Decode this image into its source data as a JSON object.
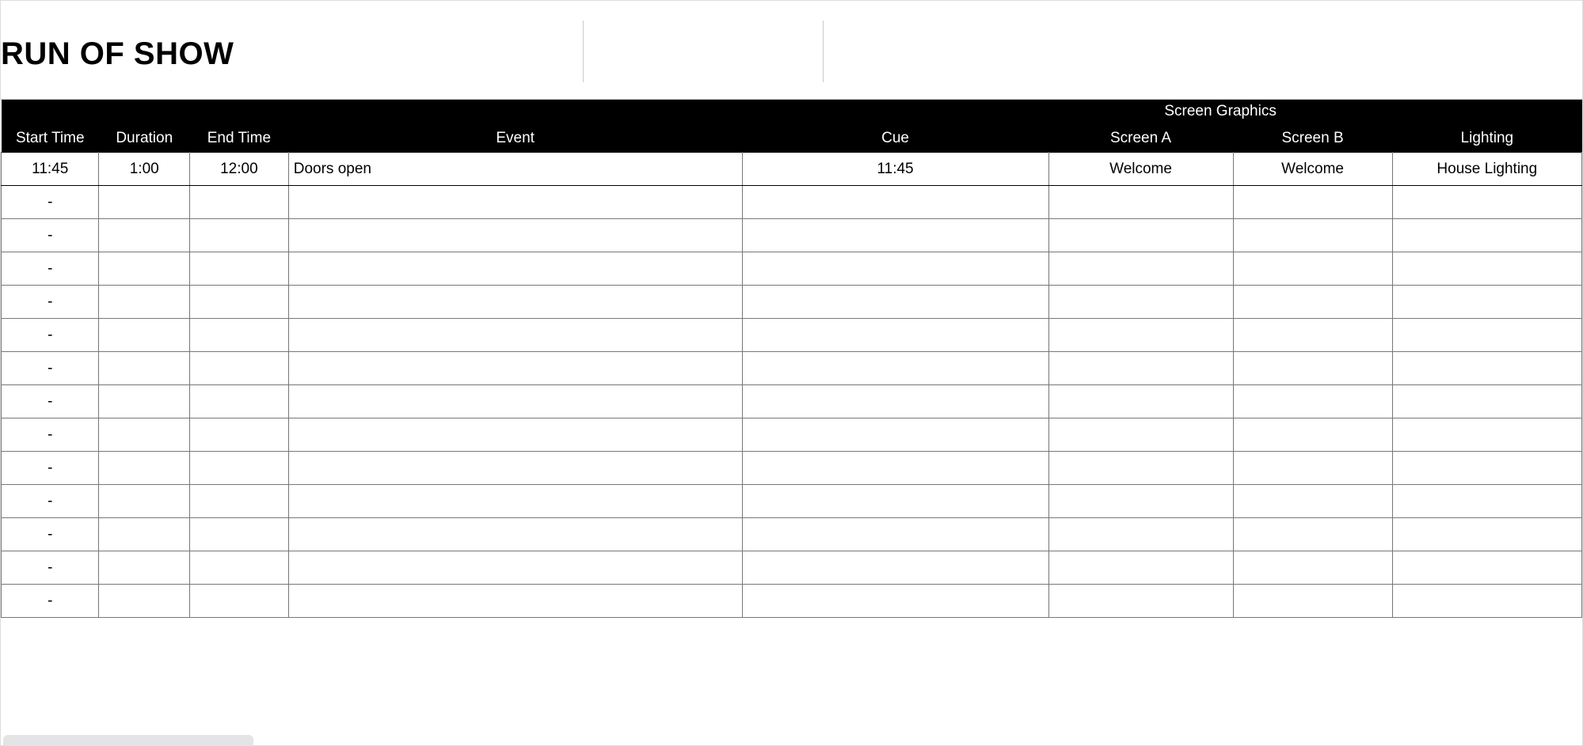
{
  "title": "RUN OF SHOW",
  "columns": {
    "group_screen_graphics": "Screen Graphics",
    "start_time": "Start Time",
    "duration": "Duration",
    "end_time": "End Time",
    "event": "Event",
    "cue": "Cue",
    "screen_a": "Screen A",
    "screen_b": "Screen B",
    "lighting": "Lighting"
  },
  "rows": [
    {
      "start_time": "11:45",
      "duration": "1:00",
      "end_time": "12:00",
      "event": "Doors open",
      "cue": "11:45",
      "screen_a": "Welcome",
      "screen_b": "Welcome",
      "lighting": "House Lighting"
    },
    {
      "start_time": "-",
      "duration": "",
      "end_time": "",
      "event": "",
      "cue": "",
      "screen_a": "",
      "screen_b": "",
      "lighting": ""
    },
    {
      "start_time": "-",
      "duration": "",
      "end_time": "",
      "event": "",
      "cue": "",
      "screen_a": "",
      "screen_b": "",
      "lighting": ""
    },
    {
      "start_time": "-",
      "duration": "",
      "end_time": "",
      "event": "",
      "cue": "",
      "screen_a": "",
      "screen_b": "",
      "lighting": ""
    },
    {
      "start_time": "-",
      "duration": "",
      "end_time": "",
      "event": "",
      "cue": "",
      "screen_a": "",
      "screen_b": "",
      "lighting": ""
    },
    {
      "start_time": "-",
      "duration": "",
      "end_time": "",
      "event": "",
      "cue": "",
      "screen_a": "",
      "screen_b": "",
      "lighting": ""
    },
    {
      "start_time": "-",
      "duration": "",
      "end_time": "",
      "event": "",
      "cue": "",
      "screen_a": "",
      "screen_b": "",
      "lighting": ""
    },
    {
      "start_time": "-",
      "duration": "",
      "end_time": "",
      "event": "",
      "cue": "",
      "screen_a": "",
      "screen_b": "",
      "lighting": ""
    },
    {
      "start_time": "-",
      "duration": "",
      "end_time": "",
      "event": "",
      "cue": "",
      "screen_a": "",
      "screen_b": "",
      "lighting": ""
    },
    {
      "start_time": "-",
      "duration": "",
      "end_time": "",
      "event": "",
      "cue": "",
      "screen_a": "",
      "screen_b": "",
      "lighting": ""
    },
    {
      "start_time": "-",
      "duration": "",
      "end_time": "",
      "event": "",
      "cue": "",
      "screen_a": "",
      "screen_b": "",
      "lighting": ""
    },
    {
      "start_time": "-",
      "duration": "",
      "end_time": "",
      "event": "",
      "cue": "",
      "screen_a": "",
      "screen_b": "",
      "lighting": ""
    },
    {
      "start_time": "-",
      "duration": "",
      "end_time": "",
      "event": "",
      "cue": "",
      "screen_a": "",
      "screen_b": "",
      "lighting": ""
    },
    {
      "start_time": "-",
      "duration": "",
      "end_time": "",
      "event": "",
      "cue": "",
      "screen_a": "",
      "screen_b": "",
      "lighting": ""
    }
  ]
}
